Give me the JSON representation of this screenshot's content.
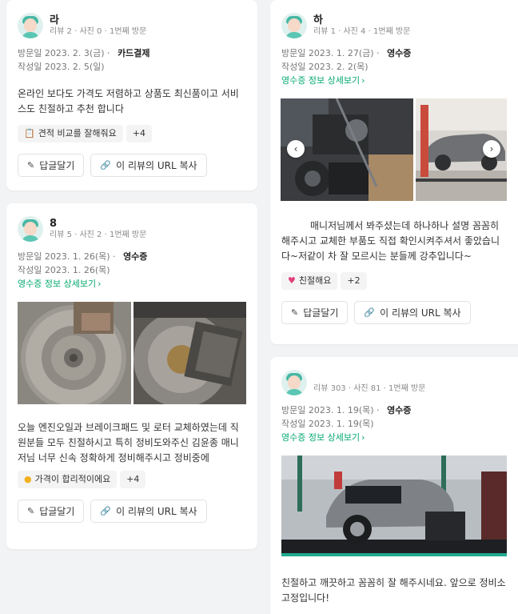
{
  "reviews": [
    {
      "nickname": "라",
      "stats": "리뷰 2 · 사진 0 · 1번째 방문",
      "visit_label": "방문일",
      "visit_date": "2023. 2. 3(금)",
      "payment": "카드결제",
      "written_label": "작성일",
      "written_date": "2023. 2. 5(일)",
      "text": "온라인 보다도 가격도 저렴하고 상품도 최신품이고 서비스도 친절하고 추천 합니다",
      "tag": "견적 비교를 잘해줘요",
      "tag_icon": "clipboard-icon",
      "more_tags": "+4",
      "reply": "답글달기",
      "copy_url": "이 리뷰의 URL 복사"
    },
    {
      "nickname": "8",
      "stats": "리뷰 5 · 사진 2 · 1번째 방문",
      "visit_label": "방문일",
      "visit_date": "2023. 1. 26(목)",
      "payment": "영수증",
      "written_label": "작성일",
      "written_date": "2023. 1. 26(목)",
      "receipt_link": "영수증 정보 상세보기",
      "text": "오늘 엔진오일과 브레이크패드 및 로터 교체하였는데 직원분들 모두 친절하시고 특히 정비도와주신 김윤종 매니저님 너무 신속 정확하게 정비해주시고 정비중에",
      "tag": "가격이 합리적이에요",
      "tag_icon": "coin-icon",
      "more_tags": "+4",
      "reply": "답글달기",
      "copy_url": "이 리뷰의 URL 복사"
    },
    {
      "nickname": "하",
      "stats": "리뷰 1 · 사진 4 · 1번째 방문",
      "visit_label": "방문일",
      "visit_date": "2023. 1. 27(금)",
      "payment": "영수증",
      "written_label": "작성일",
      "written_date": "2023. 2. 2(목)",
      "receipt_link": "영수증 정보 상세보기",
      "text": "매니저님께서 봐주셨는데 하나하나 설명 꼼꼼히 해주시고 교체한 부품도 직접 확인시켜주셔서 좋았습니다~저같이 차 잘 모르시는 분들께 강추입니다~",
      "tag": "친절해요",
      "tag_icon": "heart-icon",
      "more_tags": "+2",
      "reply": "답글달기",
      "copy_url": "이 리뷰의 URL 복사"
    },
    {
      "nickname": "",
      "stats": "리뷰 303 · 사진 81 · 1번째 방문",
      "visit_label": "방문일",
      "visit_date": "2023. 1. 19(목)",
      "payment": "영수증",
      "written_label": "작성일",
      "written_date": "2023. 1. 19(목)",
      "receipt_link": "영수증 정보 상세보기",
      "text": "친절하고 깨끗하고 꼼꼼히 잘 해주시네요. 앞으로 정비소 고정입니다!"
    }
  ],
  "colors": {
    "accent": "#03a96e",
    "card_bg": "#ffffff",
    "page_bg": "#f2f3f5"
  }
}
